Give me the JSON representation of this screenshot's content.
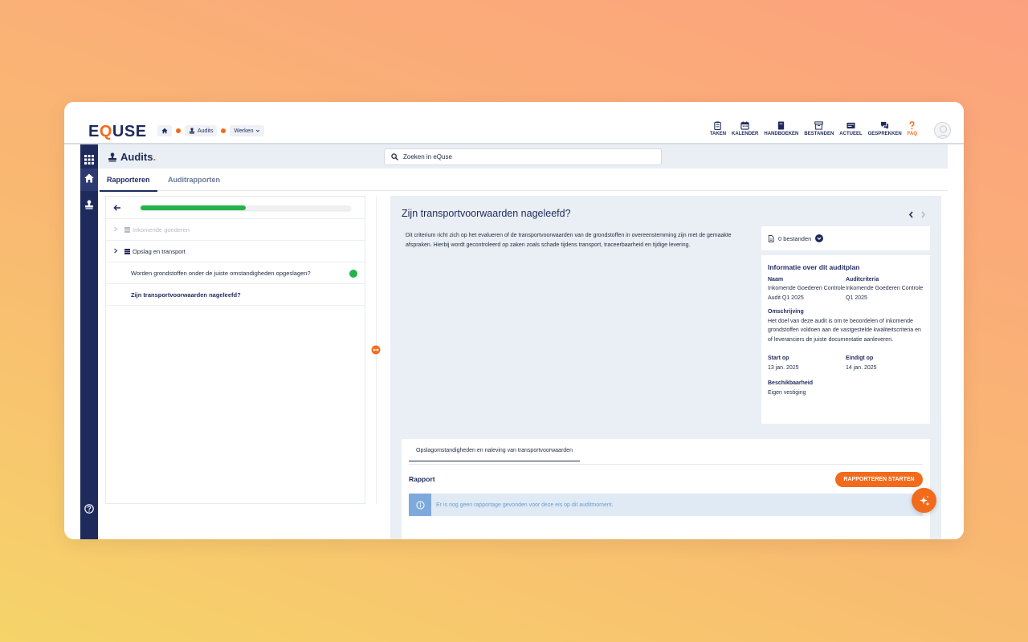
{
  "app": {
    "logo_left": "E",
    "logo_q": "Q",
    "logo_right": "USE"
  },
  "breadcrumb": {
    "home_icon": "home-icon",
    "audits": "Audits",
    "werken": "Werken"
  },
  "topnav": [
    {
      "label": "TAKEN",
      "icon": "clipboard-icon"
    },
    {
      "label": "KALENDER",
      "icon": "calendar-icon"
    },
    {
      "label": "HANDBOEKEN",
      "icon": "book-icon"
    },
    {
      "label": "BESTANDEN",
      "icon": "archive-icon"
    },
    {
      "label": "ACTUEEL",
      "icon": "news-icon"
    },
    {
      "label": "GESPREKKEN",
      "icon": "chat-icon"
    },
    {
      "label": "FAQ",
      "icon": "question-icon"
    }
  ],
  "subheader": {
    "title": "Audits",
    "title_dot": ".",
    "search_placeholder": "Zoeken in eQuse"
  },
  "tabs": {
    "rapporteren": "Rapporteren",
    "auditrapporten": "Auditrapporten"
  },
  "left_panel": {
    "progress_fraction": 0.5,
    "tree": [
      {
        "label": "Inkomende goederen"
      },
      {
        "label": "Opslag en transport"
      },
      {
        "label": "Worden grondstoffen onder de juiste omstandigheden opgeslagen?"
      },
      {
        "label": "Zijn transportvoorwaarden nageleefd?"
      }
    ]
  },
  "main": {
    "title": "Zijn transportvoorwaarden nageleefd?",
    "description": "Dit criterium richt zich op het evalueren of de transportvoorwaarden van de grondstoffen in overeenstemming zijn met de gemaakte afspraken. Hierbij wordt gecontroleerd op zaken zoals schade tijdens transport, traceerbaarheid en tijdige levering.",
    "files": "0 bestanden",
    "info": {
      "title": "Informatie over dit auditplan",
      "naam_label": "Naam",
      "naam_value": "Inkomende Goederen Controle Audit Q1 2025",
      "criteria_label": "Auditcriteria",
      "criteria_value": "Inkomende Goederen Controle Q1 2025",
      "omschrijving_label": "Omschrijving",
      "omschrijving_value": "Het doel van deze audit is om te beoordelen of inkomende grondstoffen voldoen aan de vastgestelde kwaliteitscriteria en of leveranciers de juiste documentatie aanleveren.",
      "start_label": "Start op",
      "start_value": "13 jan. 2025",
      "end_label": "Eindigt op",
      "end_value": "14 jan. 2025",
      "beschikbaarheid_label": "Beschikbaarheid",
      "beschikbaarheid_value": "Eigen vestiging"
    },
    "report": {
      "tab": "Opslagomstandigheden en naleving van transportvoorwaarden",
      "title": "Rapport",
      "start_button": "RAPPORTEREN STARTEN",
      "alert": "Er is nog geen rapportage gevonden voor deze eis op dit auditmoment."
    }
  },
  "colors": {
    "brand_navy": "#1f2a5c",
    "accent_orange": "#f26a1b",
    "success_green": "#23b34a",
    "info_blue": "#7ea9dc"
  }
}
